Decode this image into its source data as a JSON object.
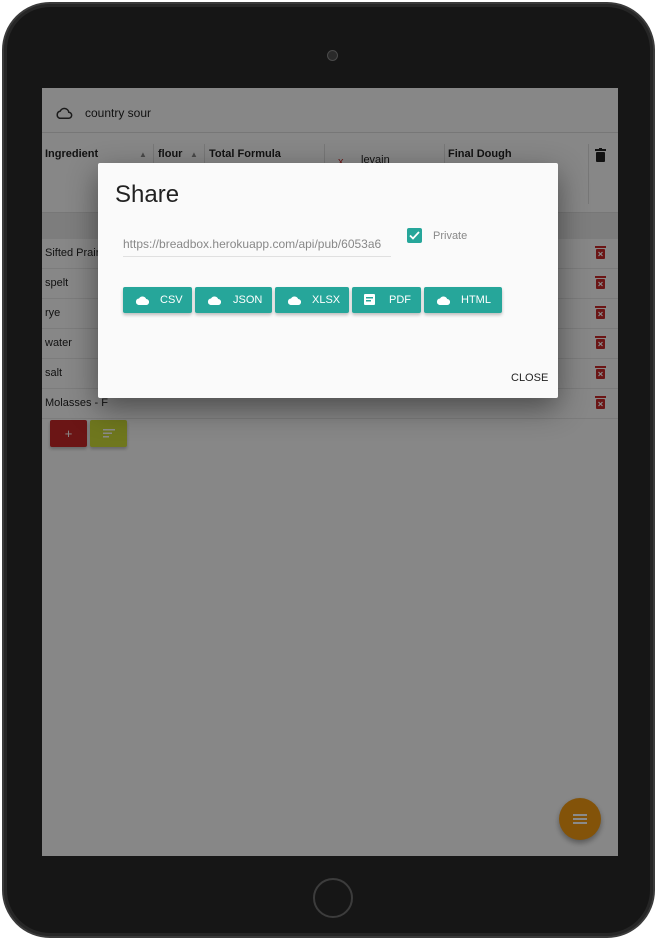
{
  "app": {
    "recipe_title": "country sour"
  },
  "table": {
    "columns": [
      {
        "label": "Ingredient"
      },
      {
        "label": "flour"
      },
      {
        "label": "Total Formula"
      },
      {
        "label": "levain",
        "prefix": "x"
      },
      {
        "label": "Final Dough"
      }
    ],
    "rows": [
      {
        "name": "Sifted Prairie"
      },
      {
        "name": "spelt"
      },
      {
        "name": "rye"
      },
      {
        "name": "water"
      },
      {
        "name": "salt"
      },
      {
        "name": "Molasses - F"
      }
    ],
    "add_label": "+",
    "colors": {
      "add": "#c62828",
      "sort": "#cddc39",
      "delete": "#c62828"
    }
  },
  "dialog": {
    "title": "Share",
    "url_value": "https://breadbox.herokuapp.com/api/pub/6053a6",
    "private_label": "Private",
    "private_checked": true,
    "buttons": [
      {
        "label": "CSV",
        "icon": "cloud-icon"
      },
      {
        "label": "JSON",
        "icon": "cloud-icon"
      },
      {
        "label": "XLSX",
        "icon": "cloud-icon"
      },
      {
        "label": "PDF",
        "icon": "pdf-icon"
      },
      {
        "label": "HTML",
        "icon": "cloud-icon"
      }
    ],
    "close_label": "CLOSE",
    "accent": "#26a69a"
  },
  "fab": {
    "icon": "menu-icon",
    "color": "#f29a12"
  }
}
